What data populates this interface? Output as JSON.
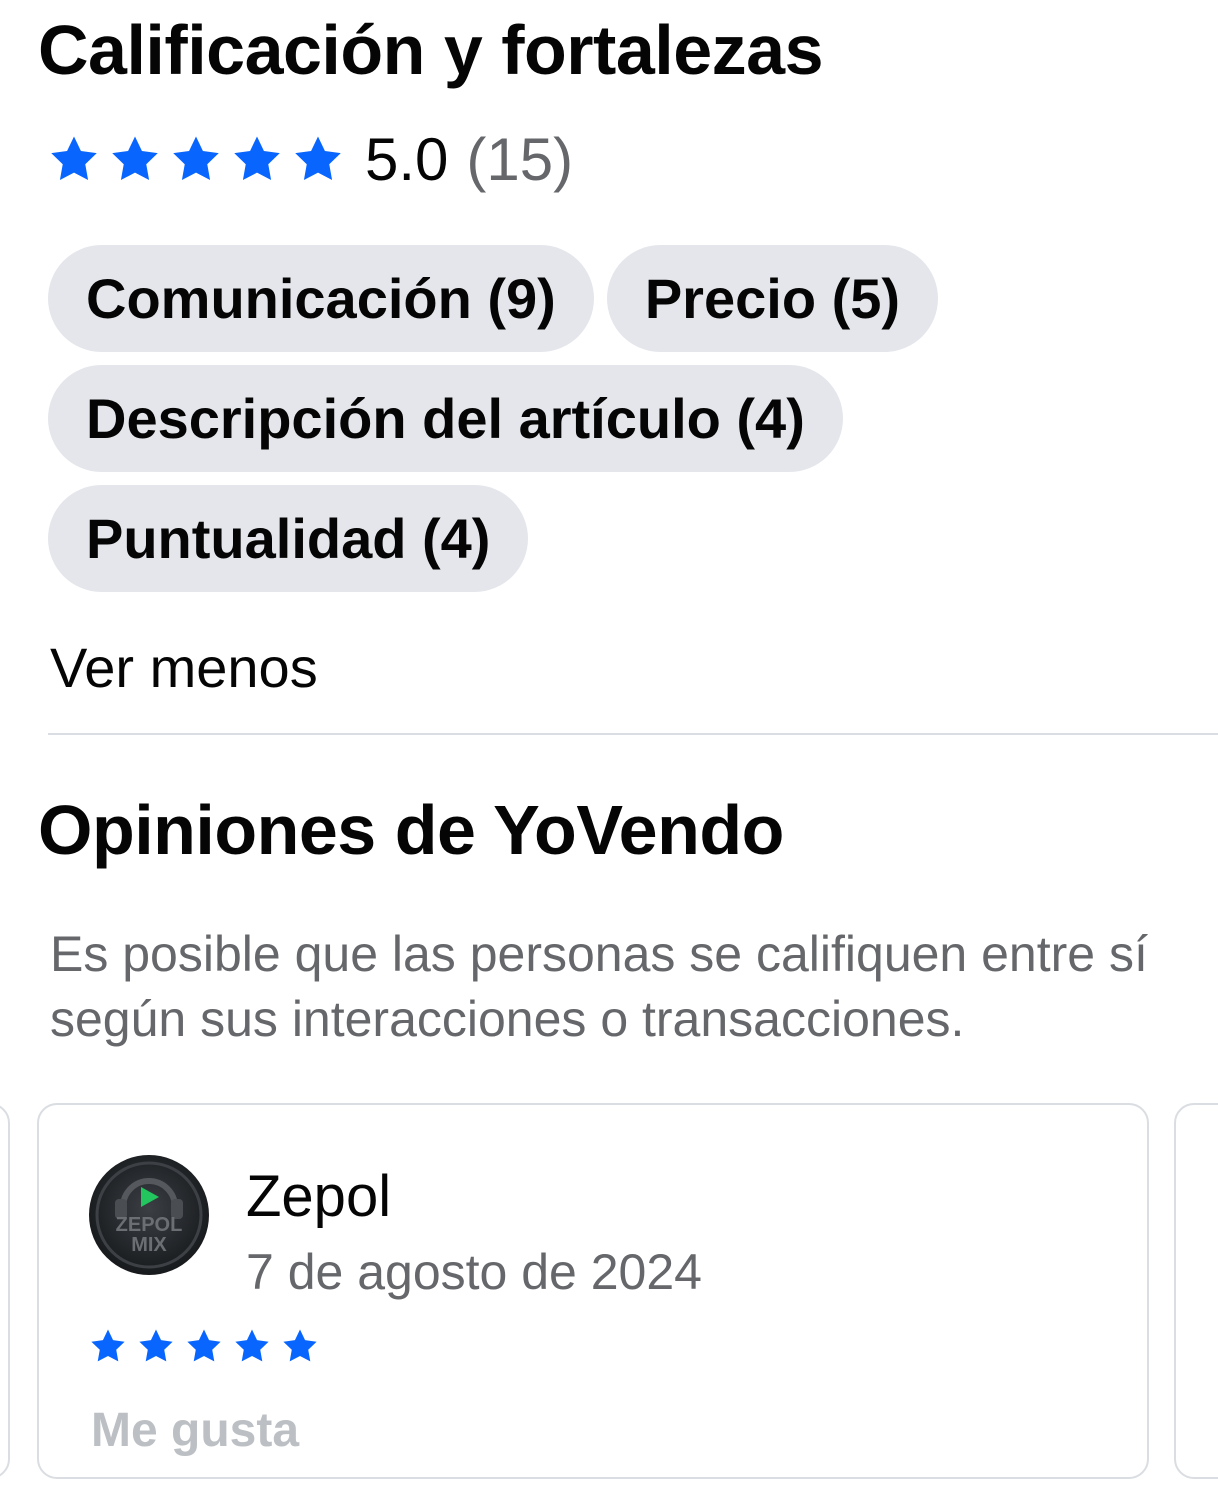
{
  "rating_section": {
    "title": "Calificación y fortalezas",
    "stars": 5,
    "star_color": "#0866ff",
    "average": "5.0",
    "count": "(15)",
    "chips": [
      {
        "label": "Comunicación (9)"
      },
      {
        "label": "Precio (5)"
      },
      {
        "label": "Descripción del artículo (4)"
      },
      {
        "label": "Puntualidad (4)"
      }
    ],
    "see_less_label": "Ver menos"
  },
  "reviews_section": {
    "title": "Opiniones de YoVendo",
    "description": "Es posible que las personas se califiquen entre sí según sus interacciones o transacciones.",
    "reviews": [
      {
        "reviewer_name": "Zepol",
        "avatar_text": "ZEPOL MIX",
        "avatar_accent": "#22c55e",
        "date": "7 de agosto de 2024",
        "stars": 5,
        "like_label": "Me gusta"
      }
    ]
  },
  "colors": {
    "chip_bg": "#e4e6eb",
    "secondary_text": "#65676b",
    "divider": "#dadde1",
    "disabled_text": "#bcc0c4"
  }
}
